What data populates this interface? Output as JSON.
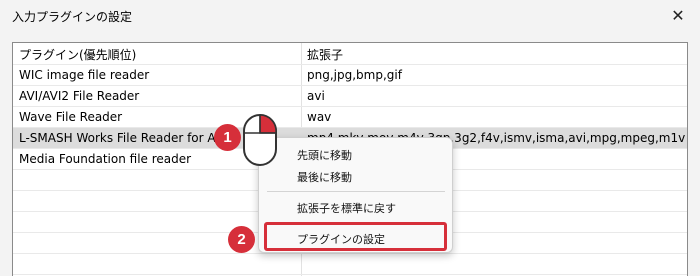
{
  "window": {
    "title": "入力プラグインの設定",
    "close_glyph": "✕"
  },
  "list": {
    "columns": [
      "プラグイン(優先順位)",
      "拡張子"
    ],
    "rows": [
      {
        "plugin": "WIC image file reader",
        "ext": "png,jpg,bmp,gif"
      },
      {
        "plugin": "AVI/AVI2 File Reader",
        "ext": "avi"
      },
      {
        "plugin": "Wave File Reader",
        "ext": "wav"
      },
      {
        "plugin": "L-SMASH Works File Reader for A",
        "ext": "mp4,mkv,mov,m4v,3gp,3g2,f4v,ismv,isma,avi,mpg,mpeg,m1v...",
        "selected": true
      },
      {
        "plugin": "Media Foundation file reader",
        "ext": ""
      }
    ]
  },
  "context_menu": {
    "items": [
      "先頭に移動",
      "最後に移動",
      "拡張子を標準に戻す",
      "プラグインの設定"
    ]
  },
  "annotations": {
    "badge_1": "1",
    "badge_2": "2",
    "accent_color": "#d62f3a"
  },
  "icons": {
    "close": "close-icon",
    "mouse": "mouse-right-click-icon"
  }
}
